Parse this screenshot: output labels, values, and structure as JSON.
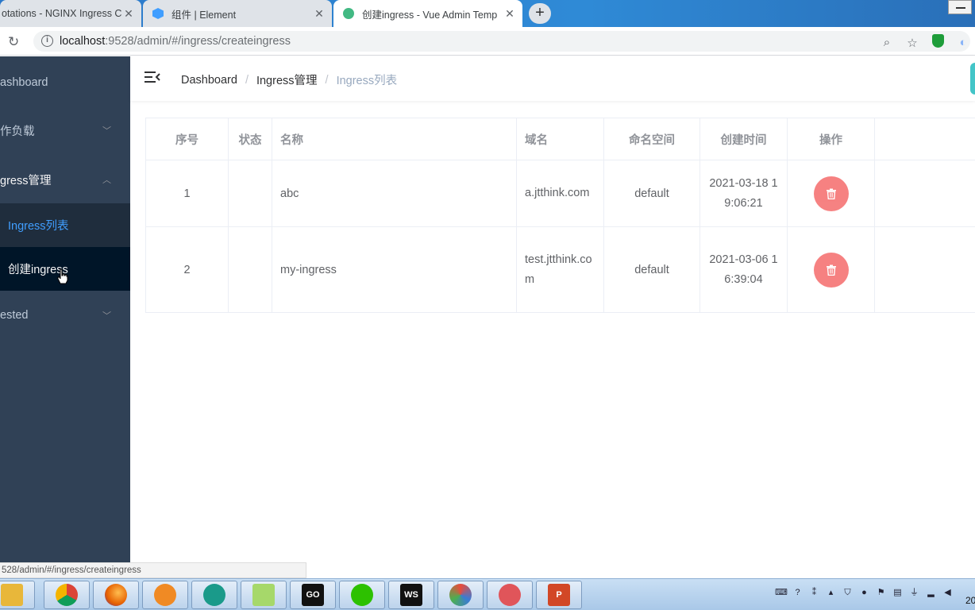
{
  "browser": {
    "tabs": [
      {
        "label": "otations - NGINX Ingress C",
        "favicon_color": "#ffffff"
      },
      {
        "label": "组件 | Element",
        "favicon_color": "#409eff"
      },
      {
        "label": "创建ingress - Vue Admin Temp",
        "favicon_color": "#42b983"
      }
    ],
    "new_tab": "+",
    "url_host": "localhost",
    "url_rest": ":9528/admin/#/ingress/createingress",
    "status_url": "528/admin/#/ingress/createingress"
  },
  "sidebar": {
    "items": [
      {
        "label": "ashboard"
      },
      {
        "label": "作负载",
        "chevron": "﹀"
      },
      {
        "label": "gress管理",
        "chevron": "︿"
      },
      {
        "label": "Ingress列表"
      },
      {
        "label": "创建ingress"
      },
      {
        "label": "ested",
        "chevron": "﹀"
      }
    ]
  },
  "breadcrumb": {
    "items": [
      "Dashboard",
      "Ingress管理",
      "Ingress列表"
    ],
    "separator": "/"
  },
  "table": {
    "headers": [
      "序号",
      "状态",
      "名称",
      "域名",
      "命名空间",
      "创建时间",
      "操作"
    ],
    "rows": [
      {
        "index": "1",
        "status": "",
        "name": "abc",
        "domain": "a.jtthink.com",
        "namespace": "default",
        "created": "2021-03-18 19:06:21"
      },
      {
        "index": "2",
        "status": "",
        "name": "my-ingress",
        "domain": "test.jtthink.com",
        "namespace": "default",
        "created": "2021-03-06 16:39:04"
      }
    ]
  },
  "taskbar": {
    "apps": [
      "file-explorer",
      "chrome",
      "firefox",
      "app-orange",
      "app-teal",
      "notepad-plus",
      "goland",
      "wechat",
      "webstorm",
      "app-swirl",
      "app-snail",
      "powerpoint"
    ],
    "go_label": "GO",
    "ws_label": "WS",
    "ppt_label": "P",
    "clock": "20"
  }
}
